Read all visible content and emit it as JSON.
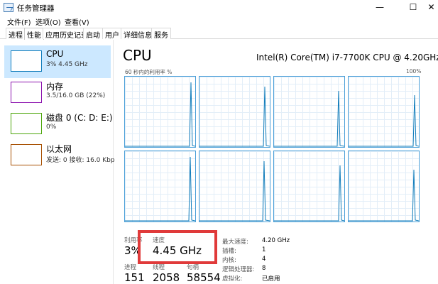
{
  "window": {
    "title": "任务管理器",
    "controls": {
      "minimize": "—",
      "maximize": "☐",
      "close": "✕"
    }
  },
  "menu": [
    "文件(F)",
    "选项(O)",
    "查看(V)"
  ],
  "tabs": [
    "进程",
    "性能",
    "应用历史记录",
    "启动",
    "用户",
    "详细信息",
    "服务"
  ],
  "active_tab": "性能",
  "devices": [
    {
      "name": "CPU",
      "detail": "3% 4.45 GHz",
      "color": "#117dbb",
      "selected": true
    },
    {
      "name": "内存",
      "detail": "3.5/16.0 GB (22%)",
      "color": "#8b12ae",
      "selected": false
    },
    {
      "name": "磁盘 0 (C: D: E:)",
      "detail": "0%",
      "color": "#4da60c",
      "selected": false
    },
    {
      "name": "以太网",
      "detail": "发送: 0 接收: 16.0 Kbp",
      "color": "#a74f01",
      "selected": false
    }
  ],
  "cpu_panel": {
    "title": "CPU",
    "model": "Intel(R) Core(TM) i7-7700K CPU @ 4.20GHz",
    "axis_left": "60 秒内的利用率 %",
    "axis_right": "100%",
    "core_count": 8
  },
  "stats": {
    "utilization_label": "利用率",
    "utilization_value": "3%",
    "speed_label": "速度",
    "speed_value": "4.45 GHz",
    "processes_label": "进程",
    "processes_value": "151",
    "threads_label": "线程",
    "threads_value": "2058",
    "handles_label": "句柄",
    "handles_value": "58554"
  },
  "details": [
    {
      "label": "最大速度:",
      "value": "4.20 GHz"
    },
    {
      "label": "插槽:",
      "value": "1"
    },
    {
      "label": "内核:",
      "value": "4"
    },
    {
      "label": "逻辑处理器:",
      "value": "8"
    },
    {
      "label": "虚拟化:",
      "value": "已启用"
    }
  ],
  "colors": {
    "accent": "#117dbb",
    "selected_bg": "#cce8ff",
    "graph_border": "#4a9fd8",
    "highlight": "#e03a3a"
  }
}
